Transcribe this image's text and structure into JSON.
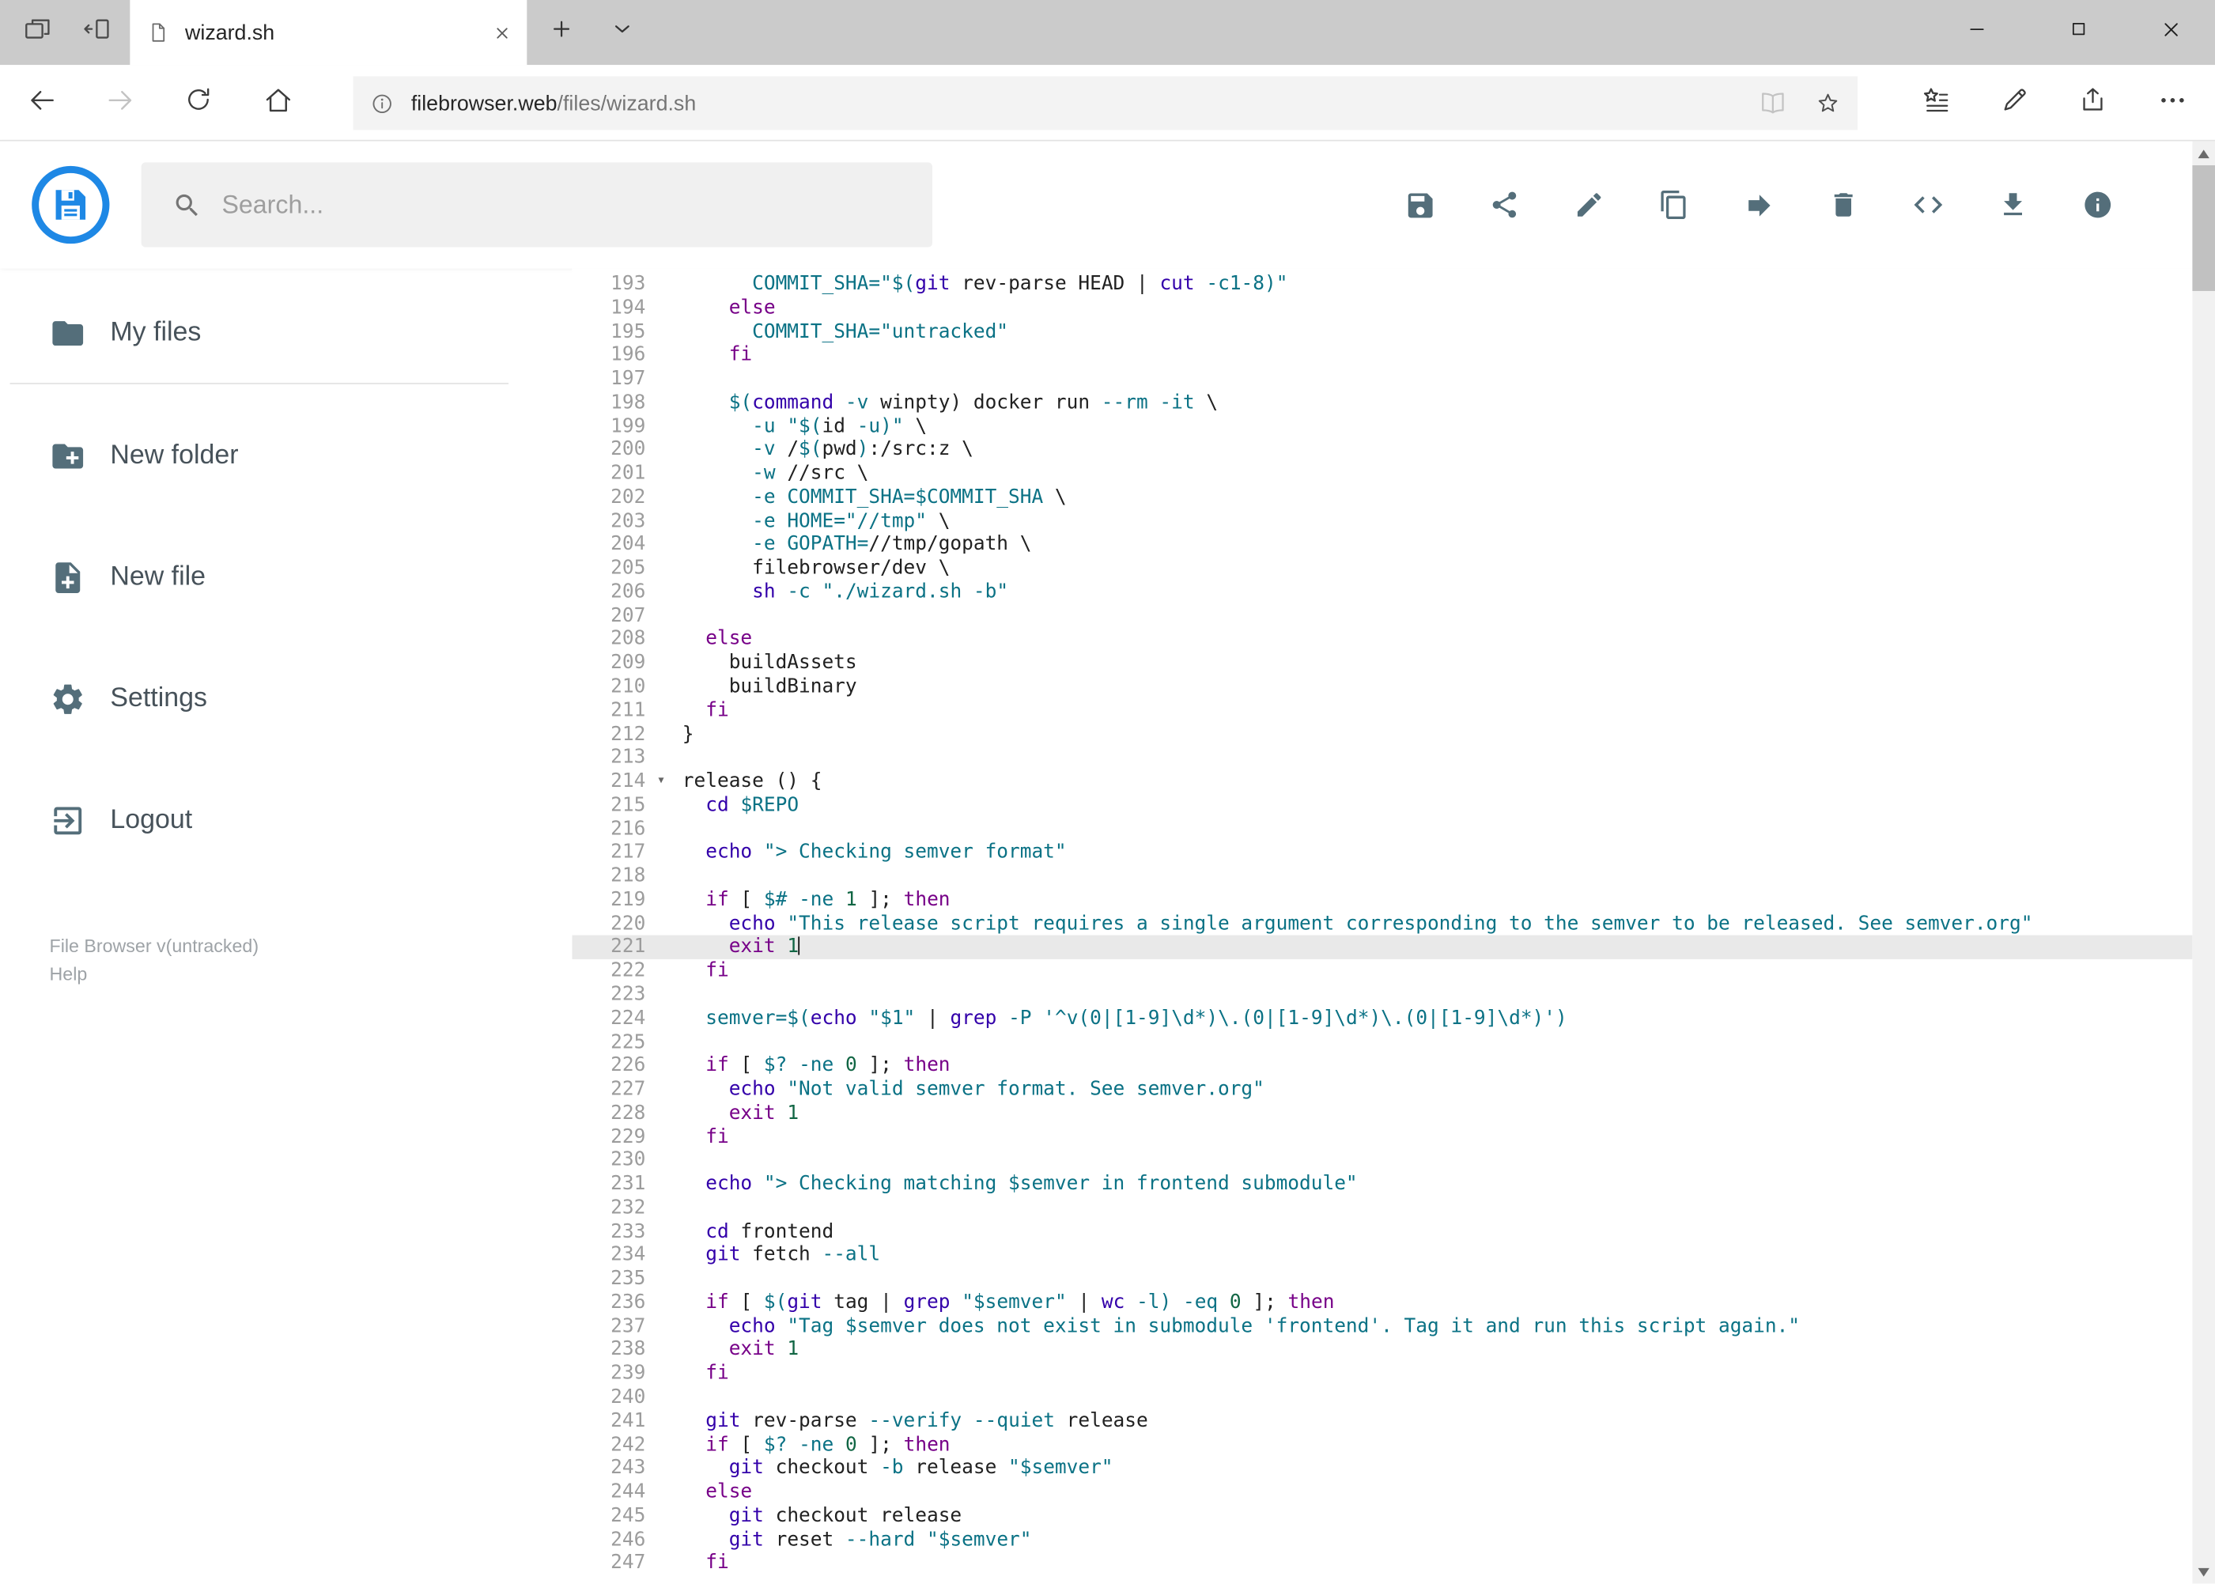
{
  "browser": {
    "tab": {
      "title": "wizard.sh"
    },
    "tabbar_icons": [
      "tab-preview-icon",
      "set-tabs-aside-icon",
      "new-tab-icon",
      "tab-menu-icon"
    ],
    "window_controls": [
      "minimize",
      "maximize",
      "close"
    ],
    "nav_icons": [
      "back-icon",
      "forward-icon",
      "refresh-icon",
      "home-icon"
    ],
    "address": {
      "info_icon": "info-icon",
      "host": "filebrowser.web",
      "path": "/files/wizard.sh",
      "field_icons": [
        "reading-view-icon",
        "favorite-star-icon"
      ]
    },
    "chrome_actions": [
      "hub-icon",
      "web-note-icon",
      "share-icon",
      "more-icon"
    ]
  },
  "app": {
    "logo_icon": "filebrowser-logo",
    "search": {
      "placeholder": "Search...",
      "icon": "search-icon"
    },
    "toolbar_icons": [
      "save-icon",
      "share-icon",
      "rename-icon",
      "copy-icon",
      "move-icon",
      "delete-icon",
      "raw-code-icon",
      "download-icon",
      "info-icon"
    ],
    "sidebar": {
      "items": [
        {
          "label": "My files",
          "icon": "folder-icon"
        },
        {
          "label": "New folder",
          "icon": "new-folder-icon"
        },
        {
          "label": "New file",
          "icon": "new-file-icon"
        },
        {
          "label": "Settings",
          "icon": "settings-icon"
        },
        {
          "label": "Logout",
          "icon": "logout-icon"
        }
      ],
      "footer": {
        "version": "File Browser v(untracked)",
        "help": "Help"
      }
    }
  },
  "editor": {
    "first_line": 193,
    "active_line": 221,
    "fold_line": 214,
    "colors": {
      "plain": "#212121",
      "keyword": "#770088",
      "builtin": "#3300aa",
      "string_var_flag": "#0b7285",
      "number": "#116644",
      "active_line_bg": "#e9e9e9",
      "gutter": "#9c9c9c"
    },
    "lines": [
      {
        "no": 193,
        "t": [
          [
            "p",
            "      "
          ],
          [
            "c",
            "COMMIT_SHA="
          ],
          [
            "c",
            "\"$("
          ],
          [
            "b",
            "git"
          ],
          [
            "p",
            " rev-parse HEAD | "
          ],
          [
            "b",
            "cut"
          ],
          [
            "p",
            " "
          ],
          [
            "c",
            "-c1-8"
          ],
          [
            "c",
            ")\""
          ]
        ]
      },
      {
        "no": 194,
        "t": [
          [
            "p",
            "    "
          ],
          [
            "k",
            "else"
          ]
        ]
      },
      {
        "no": 195,
        "t": [
          [
            "p",
            "      "
          ],
          [
            "c",
            "COMMIT_SHA="
          ],
          [
            "c",
            "\"untracked\""
          ]
        ]
      },
      {
        "no": 196,
        "t": [
          [
            "p",
            "    "
          ],
          [
            "k",
            "fi"
          ]
        ]
      },
      {
        "no": 197,
        "t": []
      },
      {
        "no": 198,
        "t": [
          [
            "p",
            "    "
          ],
          [
            "c",
            "$("
          ],
          [
            "b",
            "command"
          ],
          [
            "p",
            " "
          ],
          [
            "c",
            "-v"
          ],
          [
            "p",
            " winpty) docker run "
          ],
          [
            "c",
            "--rm"
          ],
          [
            "p",
            " "
          ],
          [
            "c",
            "-it"
          ],
          [
            "p",
            " \\"
          ]
        ]
      },
      {
        "no": 199,
        "t": [
          [
            "p",
            "      "
          ],
          [
            "c",
            "-u"
          ],
          [
            "p",
            " "
          ],
          [
            "c",
            "\"$("
          ],
          [
            "p",
            "id "
          ],
          [
            "c",
            "-u"
          ],
          [
            "c",
            ")\""
          ],
          [
            "p",
            " \\"
          ]
        ]
      },
      {
        "no": 200,
        "t": [
          [
            "p",
            "      "
          ],
          [
            "c",
            "-v"
          ],
          [
            "p",
            " /"
          ],
          [
            "c",
            "$("
          ],
          [
            "p",
            "pwd"
          ],
          [
            "c",
            ")"
          ],
          [
            "p",
            ":/src:z \\"
          ]
        ]
      },
      {
        "no": 201,
        "t": [
          [
            "p",
            "      "
          ],
          [
            "c",
            "-w"
          ],
          [
            "p",
            " //src \\"
          ]
        ]
      },
      {
        "no": 202,
        "t": [
          [
            "p",
            "      "
          ],
          [
            "c",
            "-e"
          ],
          [
            "p",
            " "
          ],
          [
            "c",
            "COMMIT_SHA=$COMMIT_SHA"
          ],
          [
            "p",
            " \\"
          ]
        ]
      },
      {
        "no": 203,
        "t": [
          [
            "p",
            "      "
          ],
          [
            "c",
            "-e"
          ],
          [
            "p",
            " "
          ],
          [
            "c",
            "HOME=\"//tmp\""
          ],
          [
            "p",
            " \\"
          ]
        ]
      },
      {
        "no": 204,
        "t": [
          [
            "p",
            "      "
          ],
          [
            "c",
            "-e"
          ],
          [
            "p",
            " "
          ],
          [
            "c",
            "GOPATH="
          ],
          [
            "p",
            "//tmp/gopath \\"
          ]
        ]
      },
      {
        "no": 205,
        "t": [
          [
            "p",
            "      filebrowser/dev \\"
          ]
        ]
      },
      {
        "no": 206,
        "t": [
          [
            "p",
            "      "
          ],
          [
            "b",
            "sh"
          ],
          [
            "p",
            " "
          ],
          [
            "c",
            "-c"
          ],
          [
            "p",
            " "
          ],
          [
            "c",
            "\"./wizard.sh -b\""
          ]
        ]
      },
      {
        "no": 207,
        "t": []
      },
      {
        "no": 208,
        "t": [
          [
            "p",
            "  "
          ],
          [
            "k",
            "else"
          ]
        ]
      },
      {
        "no": 209,
        "t": [
          [
            "p",
            "    buildAssets"
          ]
        ]
      },
      {
        "no": 210,
        "t": [
          [
            "p",
            "    buildBinary"
          ]
        ]
      },
      {
        "no": 211,
        "t": [
          [
            "p",
            "  "
          ],
          [
            "k",
            "fi"
          ]
        ]
      },
      {
        "no": 212,
        "t": [
          [
            "p",
            "}"
          ]
        ]
      },
      {
        "no": 213,
        "t": []
      },
      {
        "no": 214,
        "t": [
          [
            "p",
            "release () {"
          ]
        ]
      },
      {
        "no": 215,
        "t": [
          [
            "p",
            "  "
          ],
          [
            "b",
            "cd"
          ],
          [
            "p",
            " "
          ],
          [
            "c",
            "$REPO"
          ]
        ]
      },
      {
        "no": 216,
        "t": []
      },
      {
        "no": 217,
        "t": [
          [
            "p",
            "  "
          ],
          [
            "b",
            "echo"
          ],
          [
            "p",
            " "
          ],
          [
            "c",
            "\"> Checking semver format\""
          ]
        ]
      },
      {
        "no": 218,
        "t": []
      },
      {
        "no": 219,
        "t": [
          [
            "p",
            "  "
          ],
          [
            "k",
            "if"
          ],
          [
            "p",
            " [ "
          ],
          [
            "c",
            "$#"
          ],
          [
            "p",
            " "
          ],
          [
            "c",
            "-ne"
          ],
          [
            "p",
            " "
          ],
          [
            "n",
            "1"
          ],
          [
            "p",
            " ]; "
          ],
          [
            "k",
            "then"
          ]
        ]
      },
      {
        "no": 220,
        "t": [
          [
            "p",
            "    "
          ],
          [
            "b",
            "echo"
          ],
          [
            "p",
            " "
          ],
          [
            "c",
            "\"This release script requires a single argument corresponding to the semver to be released. See semver.org\""
          ]
        ]
      },
      {
        "no": 221,
        "t": [
          [
            "p",
            "    "
          ],
          [
            "k",
            "exit"
          ],
          [
            "p",
            " "
          ],
          [
            "n",
            "1"
          ]
        ]
      },
      {
        "no": 222,
        "t": [
          [
            "p",
            "  "
          ],
          [
            "k",
            "fi"
          ]
        ]
      },
      {
        "no": 223,
        "t": []
      },
      {
        "no": 224,
        "t": [
          [
            "p",
            "  "
          ],
          [
            "c",
            "semver="
          ],
          [
            "c",
            "$("
          ],
          [
            "b",
            "echo"
          ],
          [
            "p",
            " "
          ],
          [
            "c",
            "\"$1\""
          ],
          [
            "p",
            " | "
          ],
          [
            "b",
            "grep"
          ],
          [
            "p",
            " "
          ],
          [
            "c",
            "-P"
          ],
          [
            "p",
            " "
          ],
          [
            "c",
            "'^v(0|[1-9]\\d*)\\.(0|[1-9]\\d*)\\.(0|[1-9]\\d*)'"
          ],
          [
            "c",
            ")"
          ]
        ]
      },
      {
        "no": 225,
        "t": []
      },
      {
        "no": 226,
        "t": [
          [
            "p",
            "  "
          ],
          [
            "k",
            "if"
          ],
          [
            "p",
            " [ "
          ],
          [
            "c",
            "$?"
          ],
          [
            "p",
            " "
          ],
          [
            "c",
            "-ne"
          ],
          [
            "p",
            " "
          ],
          [
            "n",
            "0"
          ],
          [
            "p",
            " ]; "
          ],
          [
            "k",
            "then"
          ]
        ]
      },
      {
        "no": 227,
        "t": [
          [
            "p",
            "    "
          ],
          [
            "b",
            "echo"
          ],
          [
            "p",
            " "
          ],
          [
            "c",
            "\"Not valid semver format. See semver.org\""
          ]
        ]
      },
      {
        "no": 228,
        "t": [
          [
            "p",
            "    "
          ],
          [
            "k",
            "exit"
          ],
          [
            "p",
            " "
          ],
          [
            "n",
            "1"
          ]
        ]
      },
      {
        "no": 229,
        "t": [
          [
            "p",
            "  "
          ],
          [
            "k",
            "fi"
          ]
        ]
      },
      {
        "no": 230,
        "t": []
      },
      {
        "no": 231,
        "t": [
          [
            "p",
            "  "
          ],
          [
            "b",
            "echo"
          ],
          [
            "p",
            " "
          ],
          [
            "c",
            "\"> Checking matching $semver in frontend submodule\""
          ]
        ]
      },
      {
        "no": 232,
        "t": []
      },
      {
        "no": 233,
        "t": [
          [
            "p",
            "  "
          ],
          [
            "b",
            "cd"
          ],
          [
            "p",
            " frontend"
          ]
        ]
      },
      {
        "no": 234,
        "t": [
          [
            "p",
            "  "
          ],
          [
            "b",
            "git"
          ],
          [
            "p",
            " fetch "
          ],
          [
            "c",
            "--all"
          ]
        ]
      },
      {
        "no": 235,
        "t": []
      },
      {
        "no": 236,
        "t": [
          [
            "p",
            "  "
          ],
          [
            "k",
            "if"
          ],
          [
            "p",
            " [ "
          ],
          [
            "c",
            "$("
          ],
          [
            "b",
            "git"
          ],
          [
            "p",
            " tag | "
          ],
          [
            "b",
            "grep"
          ],
          [
            "p",
            " "
          ],
          [
            "c",
            "\"$semver\""
          ],
          [
            "p",
            " | "
          ],
          [
            "b",
            "wc"
          ],
          [
            "p",
            " "
          ],
          [
            "c",
            "-l"
          ],
          [
            "c",
            ")"
          ],
          [
            "p",
            " "
          ],
          [
            "c",
            "-eq"
          ],
          [
            "p",
            " "
          ],
          [
            "n",
            "0"
          ],
          [
            "p",
            " ]; "
          ],
          [
            "k",
            "then"
          ]
        ]
      },
      {
        "no": 237,
        "t": [
          [
            "p",
            "    "
          ],
          [
            "b",
            "echo"
          ],
          [
            "p",
            " "
          ],
          [
            "c",
            "\"Tag $semver does not exist in submodule 'frontend'. Tag it and run this script again.\""
          ]
        ]
      },
      {
        "no": 238,
        "t": [
          [
            "p",
            "    "
          ],
          [
            "k",
            "exit"
          ],
          [
            "p",
            " "
          ],
          [
            "n",
            "1"
          ]
        ]
      },
      {
        "no": 239,
        "t": [
          [
            "p",
            "  "
          ],
          [
            "k",
            "fi"
          ]
        ]
      },
      {
        "no": 240,
        "t": []
      },
      {
        "no": 241,
        "t": [
          [
            "p",
            "  "
          ],
          [
            "b",
            "git"
          ],
          [
            "p",
            " rev-parse "
          ],
          [
            "c",
            "--verify"
          ],
          [
            "p",
            " "
          ],
          [
            "c",
            "--quiet"
          ],
          [
            "p",
            " release"
          ]
        ]
      },
      {
        "no": 242,
        "t": [
          [
            "p",
            "  "
          ],
          [
            "k",
            "if"
          ],
          [
            "p",
            " [ "
          ],
          [
            "c",
            "$?"
          ],
          [
            "p",
            " "
          ],
          [
            "c",
            "-ne"
          ],
          [
            "p",
            " "
          ],
          [
            "n",
            "0"
          ],
          [
            "p",
            " ]; "
          ],
          [
            "k",
            "then"
          ]
        ]
      },
      {
        "no": 243,
        "t": [
          [
            "p",
            "    "
          ],
          [
            "b",
            "git"
          ],
          [
            "p",
            " checkout "
          ],
          [
            "c",
            "-b"
          ],
          [
            "p",
            " release "
          ],
          [
            "c",
            "\"$semver\""
          ]
        ]
      },
      {
        "no": 244,
        "t": [
          [
            "p",
            "  "
          ],
          [
            "k",
            "else"
          ]
        ]
      },
      {
        "no": 245,
        "t": [
          [
            "p",
            "    "
          ],
          [
            "b",
            "git"
          ],
          [
            "p",
            " checkout release"
          ]
        ]
      },
      {
        "no": 246,
        "t": [
          [
            "p",
            "    "
          ],
          [
            "b",
            "git"
          ],
          [
            "p",
            " reset "
          ],
          [
            "c",
            "--hard"
          ],
          [
            "p",
            " "
          ],
          [
            "c",
            "\"$semver\""
          ]
        ]
      },
      {
        "no": 247,
        "t": [
          [
            "p",
            "  "
          ],
          [
            "k",
            "fi"
          ]
        ]
      }
    ]
  }
}
